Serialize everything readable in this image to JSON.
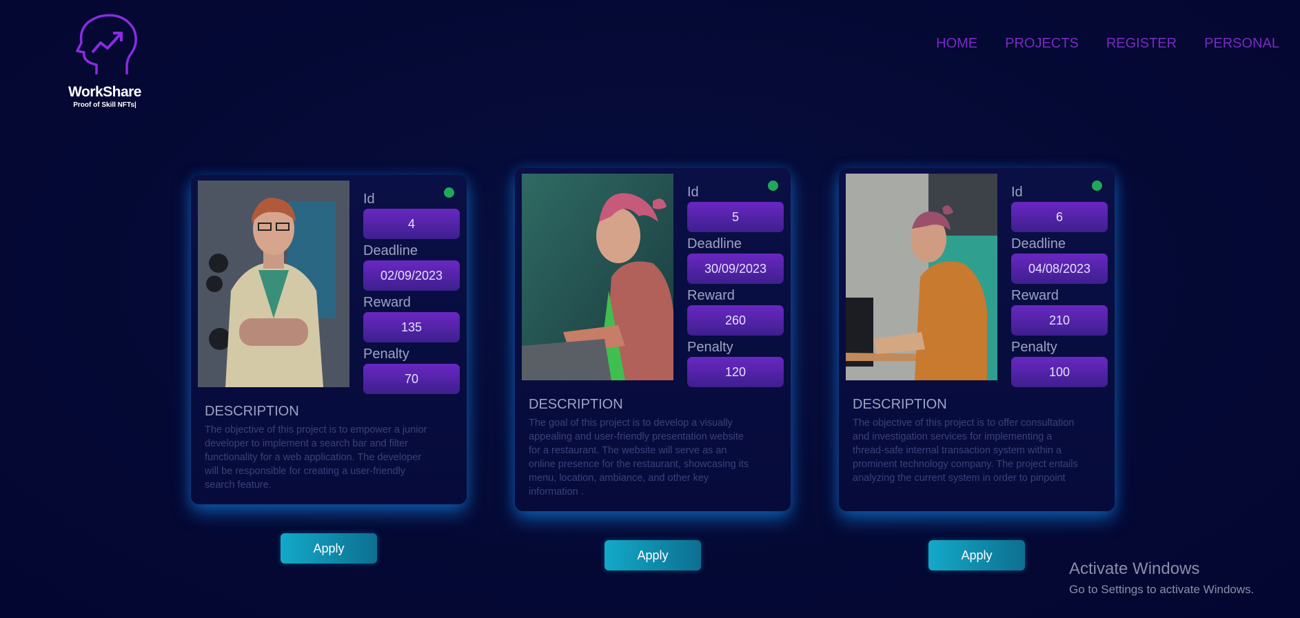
{
  "brand": {
    "name": "WorkShare",
    "tagline": "Proof of Skill NFTs|"
  },
  "nav": {
    "home": "HOME",
    "projects": "PROJECTS",
    "register": "REGISTER",
    "personal": "PERSONAL"
  },
  "labels": {
    "id": "Id",
    "deadline": "Deadline",
    "reward": "Reward",
    "penalty": "Penalty",
    "description": "DESCRIPTION",
    "apply": "Apply"
  },
  "status_color": "#1fa85a",
  "projects": [
    {
      "id": "4",
      "deadline": "02/09/2023",
      "reward": "135",
      "penalty": "70",
      "description": "The objective of this project is to empower a junior developer to implement a search bar and filter functionality for a web application. The developer will be responsible for creating a user-friendly search feature."
    },
    {
      "id": "5",
      "deadline": "30/09/2023",
      "reward": "260",
      "penalty": "120",
      "description": "The goal of this project is to develop a visually appealing and user-friendly presentation website for a restaurant. The website will serve as an online presence for the restaurant, showcasing its menu, location, ambiance, and other key information ."
    },
    {
      "id": "6",
      "deadline": "04/08/2023",
      "reward": "210",
      "penalty": "100",
      "description": "The objective of this project is to offer consultation and investigation services for implementing a thread-safe internal transaction system within a prominent technology company. The project entails analyzing the current system in order to pinpoint"
    }
  ],
  "watermark": {
    "title": "Activate Windows",
    "subtitle": "Go to Settings to activate Windows."
  }
}
